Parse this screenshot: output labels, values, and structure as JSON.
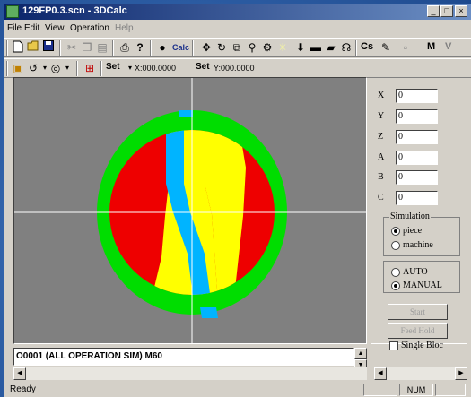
{
  "window": {
    "title": "129FP0.3.scn - 3DCalc",
    "minimize": "_",
    "maximize": "□",
    "close": "×"
  },
  "menu": [
    "File",
    "Edit",
    "View",
    "Operation",
    "Help"
  ],
  "toolbar": {
    "calc_label": "Calc",
    "cs_label": "Cs",
    "m_label": "M",
    "v_label": "V"
  },
  "toolbar2": {
    "set_x_label": "Set",
    "x_value": "X:000.0000",
    "set_y_label": "Set",
    "y_value": "Y:000.0000"
  },
  "axes": [
    {
      "label": "X",
      "value": "0"
    },
    {
      "label": "Y",
      "value": "0"
    },
    {
      "label": "Z",
      "value": "0"
    },
    {
      "label": "A",
      "value": "0"
    },
    {
      "label": "B",
      "value": "0"
    },
    {
      "label": "C",
      "value": "0"
    }
  ],
  "simulation": {
    "title": "Simulation",
    "options": [
      "piece",
      "machine"
    ],
    "selected": "piece"
  },
  "mode": {
    "options": [
      "AUTO",
      "MANUAL"
    ],
    "selected": "MANUAL"
  },
  "buttons": {
    "start": "Start",
    "feed_hold": "Feed Hold",
    "single_block": "Single Bloc"
  },
  "program": {
    "line": "O0001     (ALL OPERATION SIM) M60"
  },
  "status": {
    "text": "Ready",
    "num": "NUM"
  },
  "colors": {
    "outer_ring": "#00dd00",
    "side_lobes": "#ee0000",
    "center_band": "#ffff00",
    "cut_path": "#00b4ff",
    "background": "#808080"
  }
}
